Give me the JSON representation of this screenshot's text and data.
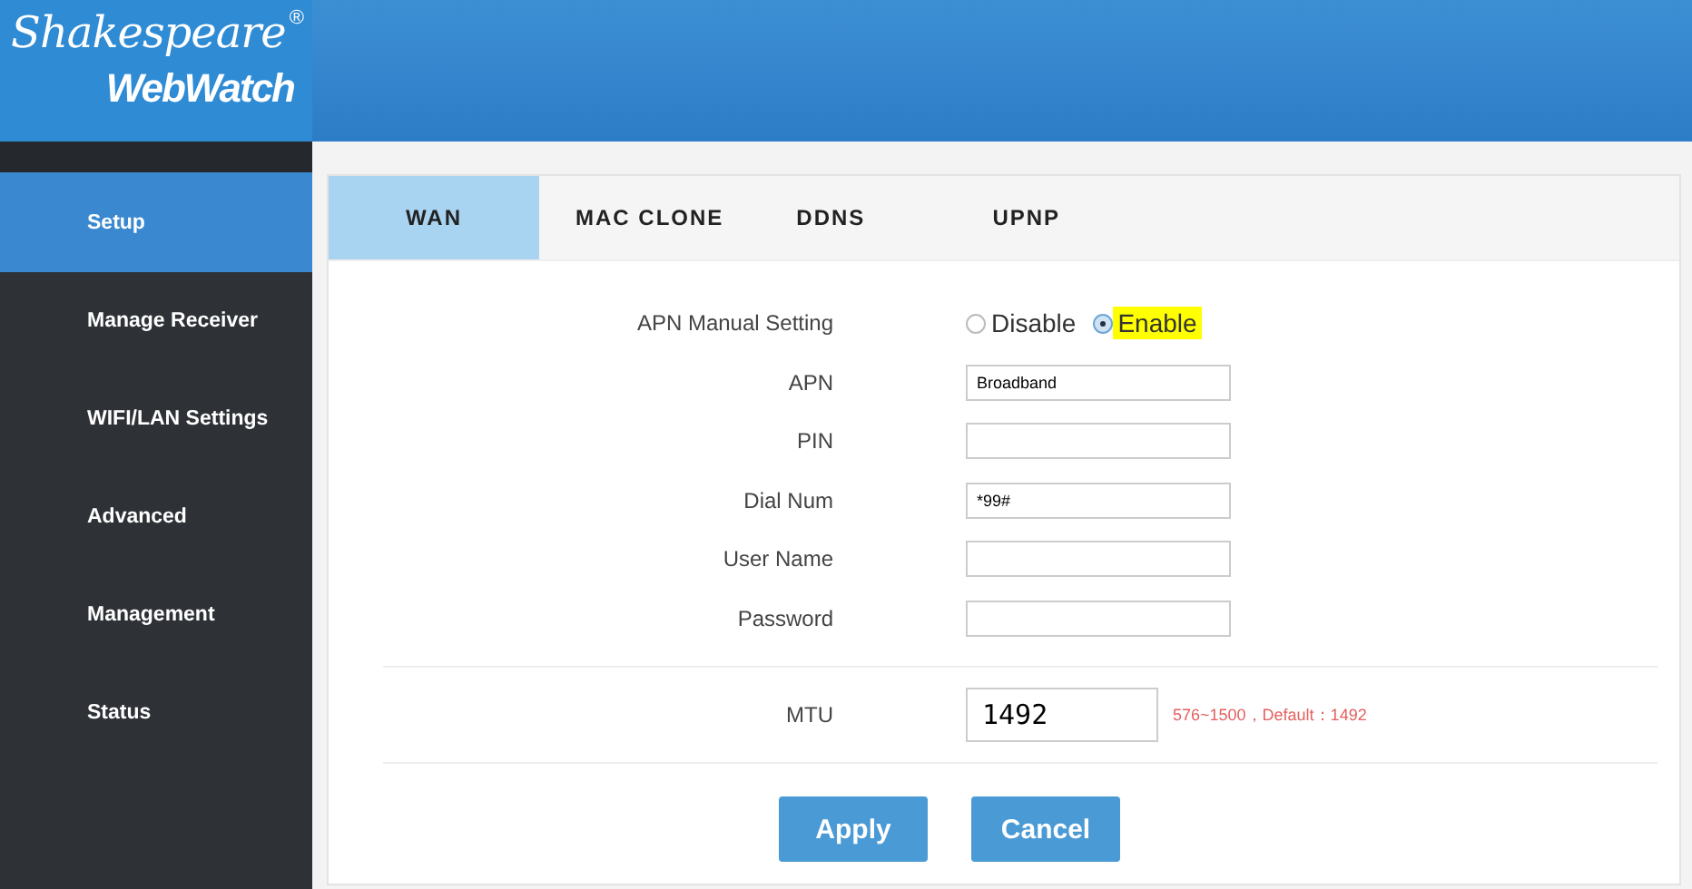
{
  "logo": {
    "script": "Shakespeare",
    "registered": "®",
    "product": "WebWatch"
  },
  "sidebar": {
    "items": [
      {
        "label": "Setup",
        "selected": true
      },
      {
        "label": "Manage Receiver",
        "selected": false
      },
      {
        "label": "WIFI/LAN Settings",
        "selected": false
      },
      {
        "label": "Advanced",
        "selected": false
      },
      {
        "label": "Management",
        "selected": false
      },
      {
        "label": "Status",
        "selected": false
      }
    ]
  },
  "tabs": [
    {
      "label": "WAN",
      "selected": true
    },
    {
      "label": "MAC CLONE",
      "selected": false
    },
    {
      "label": "DDNS",
      "selected": false
    },
    {
      "label": "UPNP",
      "selected": false
    }
  ],
  "form": {
    "fields": [
      {
        "kind": "radio",
        "label": "APN Manual Setting",
        "options": [
          {
            "label": "Disable",
            "selected": false,
            "highlighted": false
          },
          {
            "label": "Enable",
            "selected": true,
            "highlighted": true
          }
        ]
      },
      {
        "kind": "text",
        "label": "APN",
        "value": "Broadband"
      },
      {
        "kind": "text",
        "label": "PIN"
      },
      {
        "kind": "text",
        "label": "Dial Num",
        "value": "*99#"
      },
      {
        "kind": "text",
        "label": "User Name"
      },
      {
        "kind": "text",
        "label": "Password"
      }
    ],
    "mtu": {
      "label": "MTU",
      "value": "1492",
      "hint": "576~1500，Default：1492"
    }
  },
  "buttons": [
    "Apply",
    "Cancel"
  ]
}
